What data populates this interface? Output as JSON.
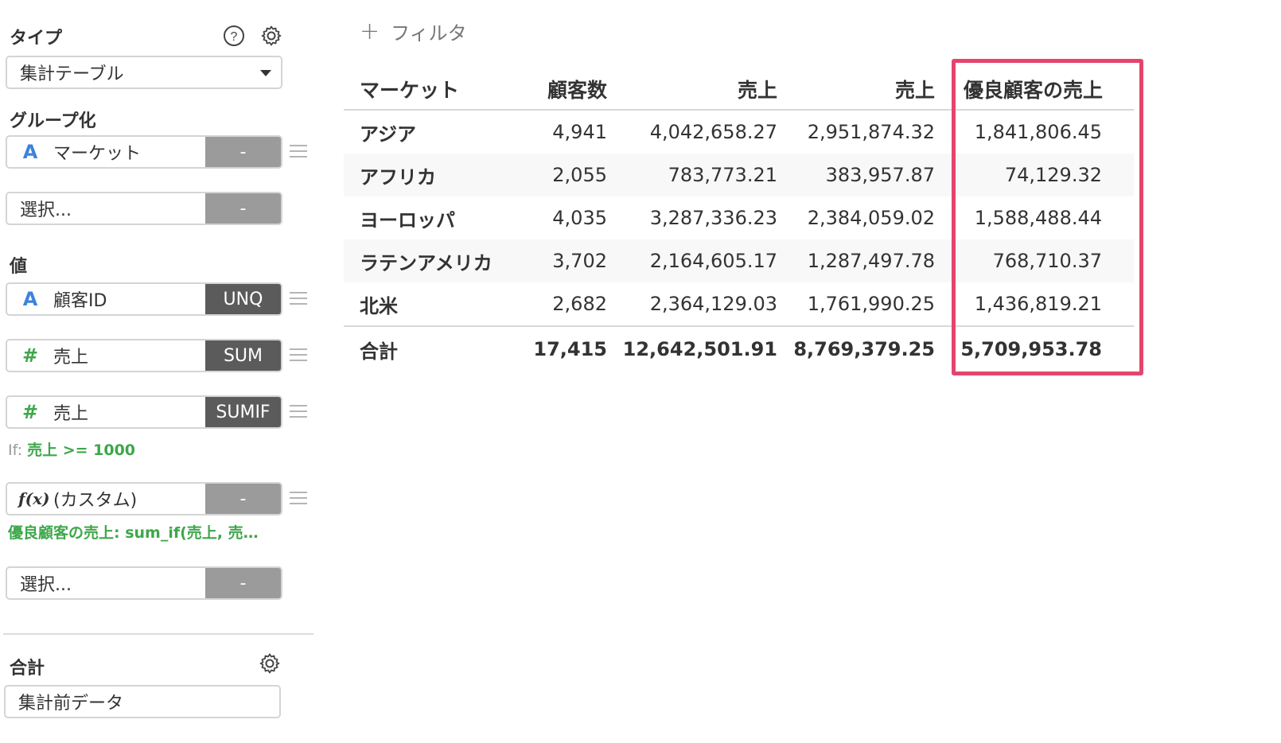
{
  "panel": {
    "type_section": {
      "title": "タイプ",
      "selected": "集計テーブル"
    },
    "group_section": {
      "title": "グループ化",
      "fields": [
        {
          "name": "マーケット",
          "type_glyph": "A",
          "agg": "-"
        }
      ],
      "add_placeholder": "選択...",
      "add_agg": "-"
    },
    "value_section": {
      "title": "値",
      "fields": [
        {
          "name": "顧客ID",
          "type_glyph": "A",
          "agg": "UNQ"
        },
        {
          "name": "売上",
          "type_glyph": "#",
          "agg": "SUM"
        },
        {
          "name": "売上",
          "type_glyph": "#",
          "agg": "SUMIF"
        },
        {
          "name": "(カスタム)",
          "type_glyph": "f(x)",
          "agg": "-"
        }
      ],
      "condition": {
        "label": "If:",
        "value": "売上 >= 1000"
      },
      "formula": "優良顧客の売上: sum_if(売上, 売…",
      "add_placeholder": "選択...",
      "add_agg": "-"
    },
    "total_section": {
      "title": "合計",
      "value": "集計前データ"
    }
  },
  "main": {
    "filter_label": "フィルタ",
    "table": {
      "headers": [
        "マーケット",
        "顧客数",
        "売上",
        "売上",
        "優良顧客の売上"
      ],
      "rows": [
        [
          "アジア",
          "4,941",
          "4,042,658.27",
          "2,951,874.32",
          "1,841,806.45"
        ],
        [
          "アフリカ",
          "2,055",
          "783,773.21",
          "383,957.87",
          "74,129.32"
        ],
        [
          "ヨーロッパ",
          "4,035",
          "3,287,336.23",
          "2,384,059.02",
          "1,588,488.44"
        ],
        [
          "ラテンアメリカ",
          "3,702",
          "2,164,605.17",
          "1,287,497.78",
          "768,710.37"
        ],
        [
          "北米",
          "2,682",
          "2,364,129.03",
          "1,761,990.25",
          "1,436,819.21"
        ]
      ],
      "total": [
        "合計",
        "17,415",
        "12,642,501.91",
        "8,769,379.25",
        "5,709,953.78"
      ]
    },
    "highlight_color": "#e4446f"
  },
  "colors": {
    "type_text_icon": "#3f83d8",
    "type_number_icon": "#3ea74a",
    "agg_active": "#5b5b5b",
    "agg_inactive": "#9b9b9b"
  },
  "icons": {
    "help": "question-circle-icon",
    "settings": "gear-icon",
    "drag": "drag-handle-icon"
  }
}
